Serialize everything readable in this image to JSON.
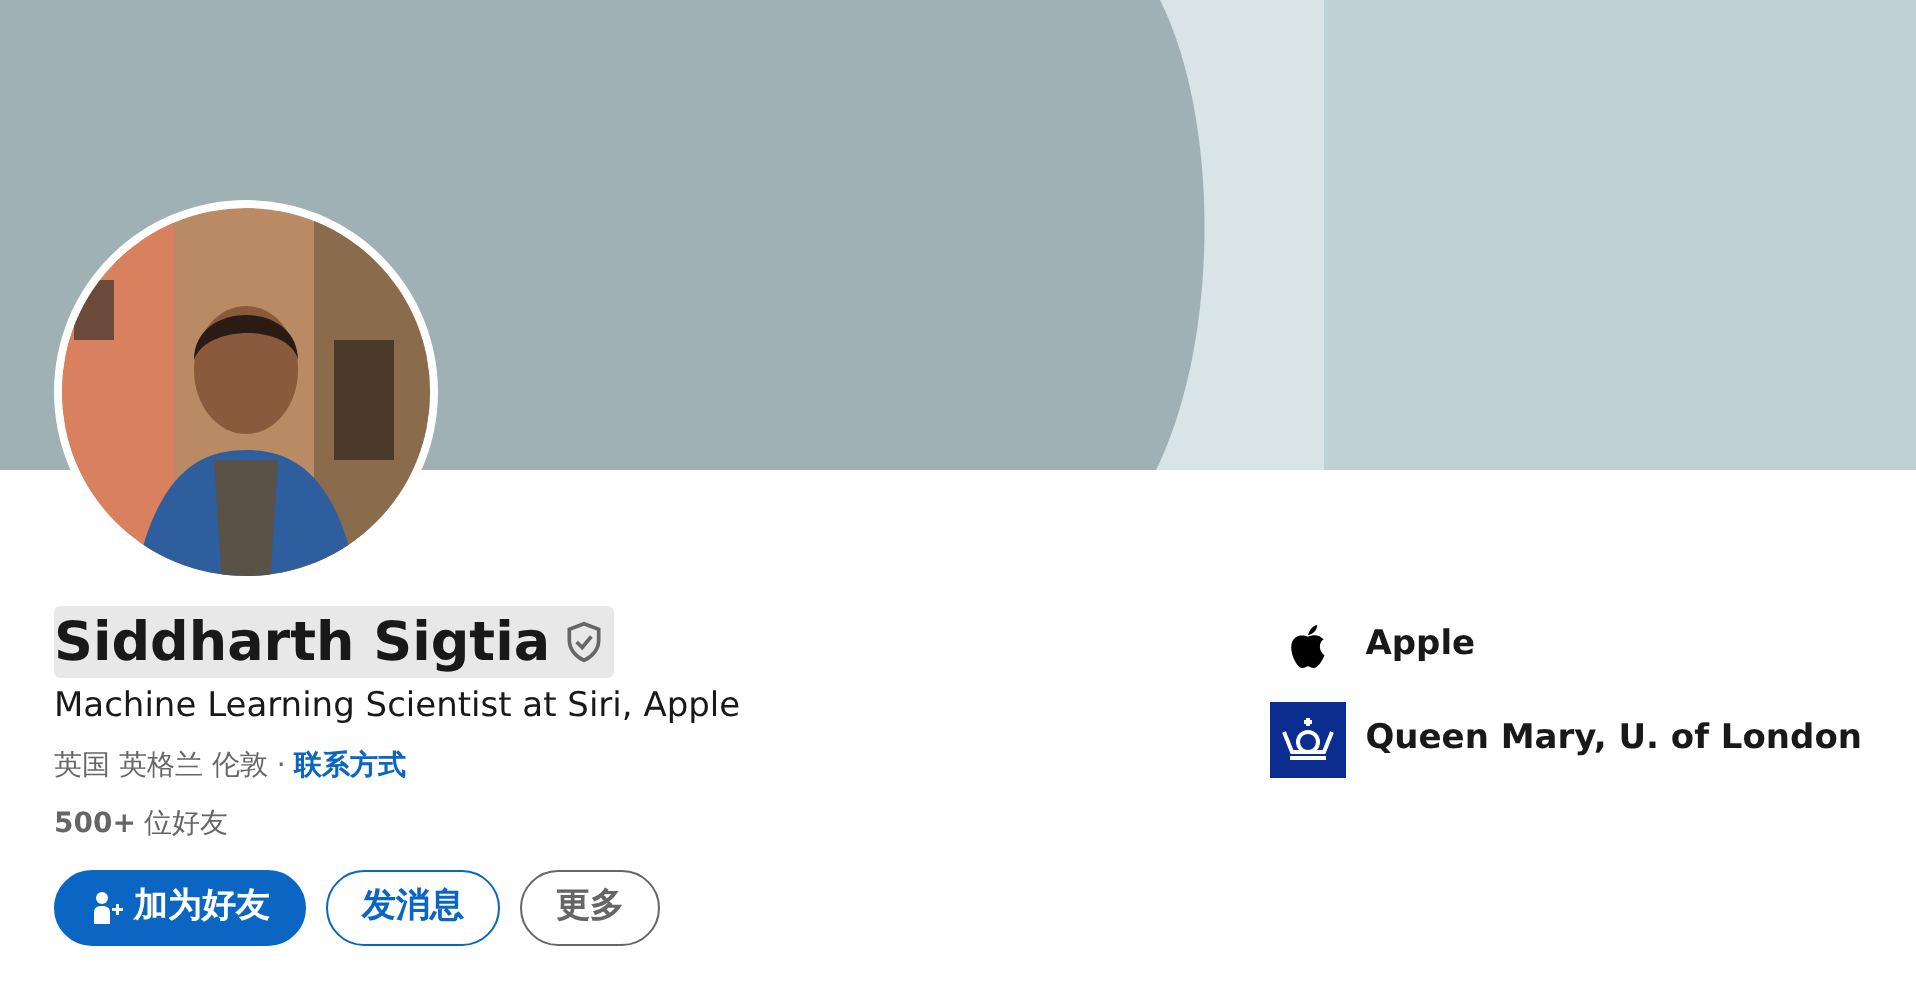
{
  "profile": {
    "name": "Siddharth Sigtia",
    "verified": true,
    "headline": "Machine Learning Scientist at Siri, Apple",
    "location": "英国 英格兰 伦敦 ·",
    "contact_link": "联系方式",
    "connections_count": "500+",
    "connections_label": "位好友"
  },
  "actions": [
    {
      "label": "加为好友",
      "kind": "primary"
    },
    {
      "label": "发消息",
      "kind": "secondary"
    },
    {
      "label": "更多",
      "kind": "tertiary"
    }
  ],
  "affiliations": [
    {
      "name": "Apple",
      "kind": "company"
    },
    {
      "name": "Queen Mary, U. of London",
      "kind": "school"
    }
  ]
}
